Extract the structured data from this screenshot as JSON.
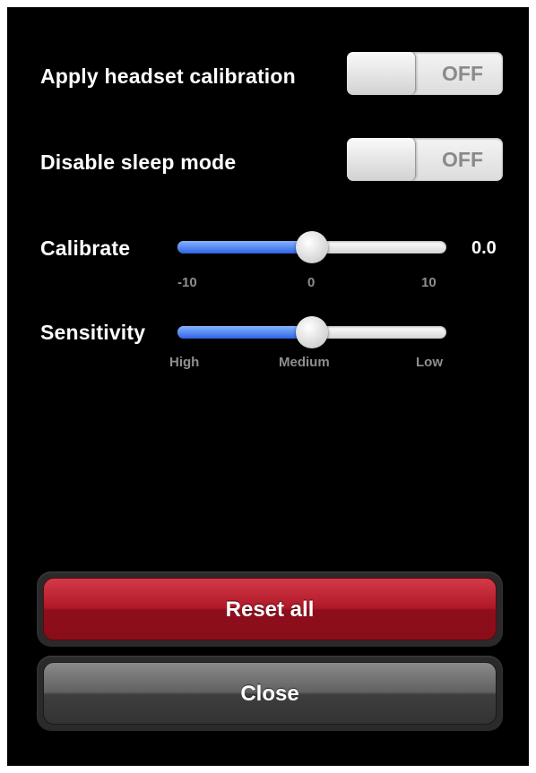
{
  "settings": {
    "headset_calibration": {
      "label": "Apply headset calibration",
      "state": "OFF"
    },
    "sleep_mode": {
      "label": "Disable sleep mode",
      "state": "OFF"
    }
  },
  "calibrate": {
    "label": "Calibrate",
    "value": "0.0",
    "level": 0.5,
    "ticks": [
      "-10",
      "0",
      "10"
    ]
  },
  "sensitivity": {
    "label": "Sensitivity",
    "level": 0.5,
    "ticks": [
      "High",
      "Medium",
      "Low"
    ]
  },
  "buttons": {
    "reset": "Reset all",
    "close": "Close"
  },
  "colors": {
    "accent_blue": "#2f64e6",
    "reset_red": "#b01828",
    "close_gray": "#616161"
  }
}
